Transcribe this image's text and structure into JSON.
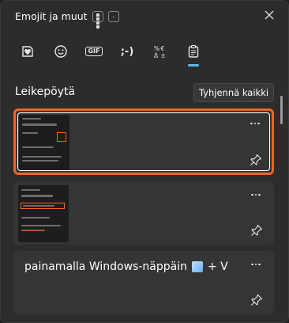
{
  "window": {
    "title": "Emojit ja muut",
    "shortcut_key": "."
  },
  "tabs": [
    {
      "name": "kaomoji-heart",
      "icon": "heart-sticker-icon"
    },
    {
      "name": "emoji",
      "icon": "smiley-icon"
    },
    {
      "name": "gif",
      "icon": "gif-icon",
      "label": "GIF"
    },
    {
      "name": "kaomoji",
      "icon": "kaomoji-icon",
      "label": ";-)"
    },
    {
      "name": "symbols",
      "icon": "symbols-icon"
    },
    {
      "name": "clipboard",
      "icon": "clipboard-icon",
      "active": true
    }
  ],
  "clipboard": {
    "title": "Leikepöytä",
    "clear_label": "Tyhjennä kaikki",
    "items": [
      {
        "type": "image",
        "selected": true
      },
      {
        "type": "image",
        "selected": false
      },
      {
        "type": "text",
        "text": "painamalla Windows-näppäin",
        "suffix": "+ V"
      }
    ]
  },
  "colors": {
    "accent": "#62b8f0",
    "highlight": "#f26522",
    "panel": "#2c2c2c",
    "item": "#353535"
  }
}
